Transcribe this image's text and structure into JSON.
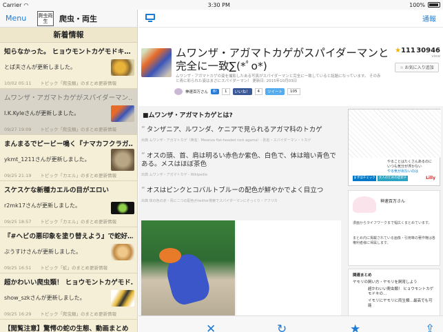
{
  "status": {
    "carrier": "Carrier",
    "time": "3:30 PM",
    "battery": "100%"
  },
  "sidebar": {
    "menu_label": "Menu",
    "logo_text": "爬虫両生",
    "app_title": "爬虫・両生",
    "section_title": "新着情報",
    "items": [
      {
        "title": "知らなかった。 ヒョウモントカゲモドキ…",
        "sub": "とぱ夫さんが更新しました。",
        "meta": "10/02 05:11　　トピック「爬虫類」のまとめ更新情報"
      },
      {
        "title": "ムワンザ・アガマトカゲがスパイダーマン…",
        "sub": "I.K.Kyleさんが更新しました。",
        "meta": "09/27 19:09　　トピック「爬虫類」のまとめ更新情報"
      },
      {
        "title": "まんまるでピービー鳴く『ナマカフクラガ…",
        "sub": "ykmt_1211さんが更新しました。",
        "meta": "09/25 21:19　　トピック「カエル」のまとめ更新情報"
      },
      {
        "title": "スケスケな新種カエルの目がエロい",
        "sub": "r2mk17さんが更新しました。",
        "meta": "09/25 18:57　　トピック「カエル」のまとめ更新情報"
      },
      {
        "title": "『#ヘビの悪印象を塗り替えよう』で蛇好…",
        "sub": "ぶうすけさんが更新しました。",
        "meta": "09/25 16:51　　トピック「蛇」のまとめ更新情報"
      },
      {
        "title": "超かわいい爬虫類！ ヒョウモントカゲモド…",
        "sub": "show_szkさんが更新しました。",
        "meta": "09/25 16:29　　トピック「爬虫類」のまとめ更新情報"
      },
      {
        "title": "【閲覧注意】驚愕の蛇の生態、動画まとめ",
        "sub": "",
        "meta": ""
      }
    ]
  },
  "main": {
    "report_label": "通報",
    "article": {
      "title": "ムワンザ・アガマトカゲがスパイダーマンと完全に一致∑(*ﾟo*)",
      "desc": "ムワンザ・アガマトカゲの姿を撮影したある写真がスパイダーマンと完全に一致していると話題になっています。 その赤と青に彩られた姿はまさにスパイダーマン！ 更新日: 2015年10月03日",
      "favorites": "111",
      "views": "30946",
      "view_label": "view",
      "fav_button": "お気に入り追加",
      "author": "神速百万さん",
      "share": {
        "like_label": "いいね！",
        "like_count": "4",
        "tweet_label": "ツイート",
        "tweet_count": "105",
        "hatena_count": "1"
      }
    },
    "content": {
      "heading": "■ムワンザ・アガマトカゲとは?",
      "quotes": [
        {
          "text": "タンザニア、ルワンダ、ケニアで見られるアガマ科のトカゲ",
          "src": "出典 ムワンザ・アガマトカゲ（英名：Mwanza flat-headed rock agama）- 別名・スパイダーマン・トカゲ"
        },
        {
          "text": "オスの頭、首、肩は明るい赤色か紫色、白色で、体は暗い青色である。メスはほぼ茶色",
          "src": "出典 ムワンザ・アガマトカゲ - Wikipedia"
        },
        {
          "text": "オスはピンクとコバルトブルーの配色が鮮やかでよく目立つ",
          "src": "出典 体の色の赤・青に二つの配色がtwitter検索でスパイダーマンにそっくり・アフリカ"
        }
      ]
    },
    "rail": {
      "ad_lines": [
        "やることはたくさんあるのに",
        "いつも気分が浮かない",
        "やる気が出ないのは"
      ],
      "ad_btn1": "まずはチェック",
      "ad_btn2": "大人のための症状チェック",
      "ad_brand": "Lilly",
      "profile_name": "神速百万さん",
      "profile_lines": [
        "漫画からライフワークまで幅広くまとめています。",
        "まとめ内に掲載されている画像・引用等の著作権は各権利者様に帰属します。"
      ],
      "related_title": "関連まとめ",
      "related_items": [
        "ヤモリの飼い方・ヤモリを飼育しよう",
        "超かわいい爬虫類！ ヒョウモントカゲモドキの…",
        "イモリにヤモリに両生類…最高でも可能"
      ]
    }
  }
}
